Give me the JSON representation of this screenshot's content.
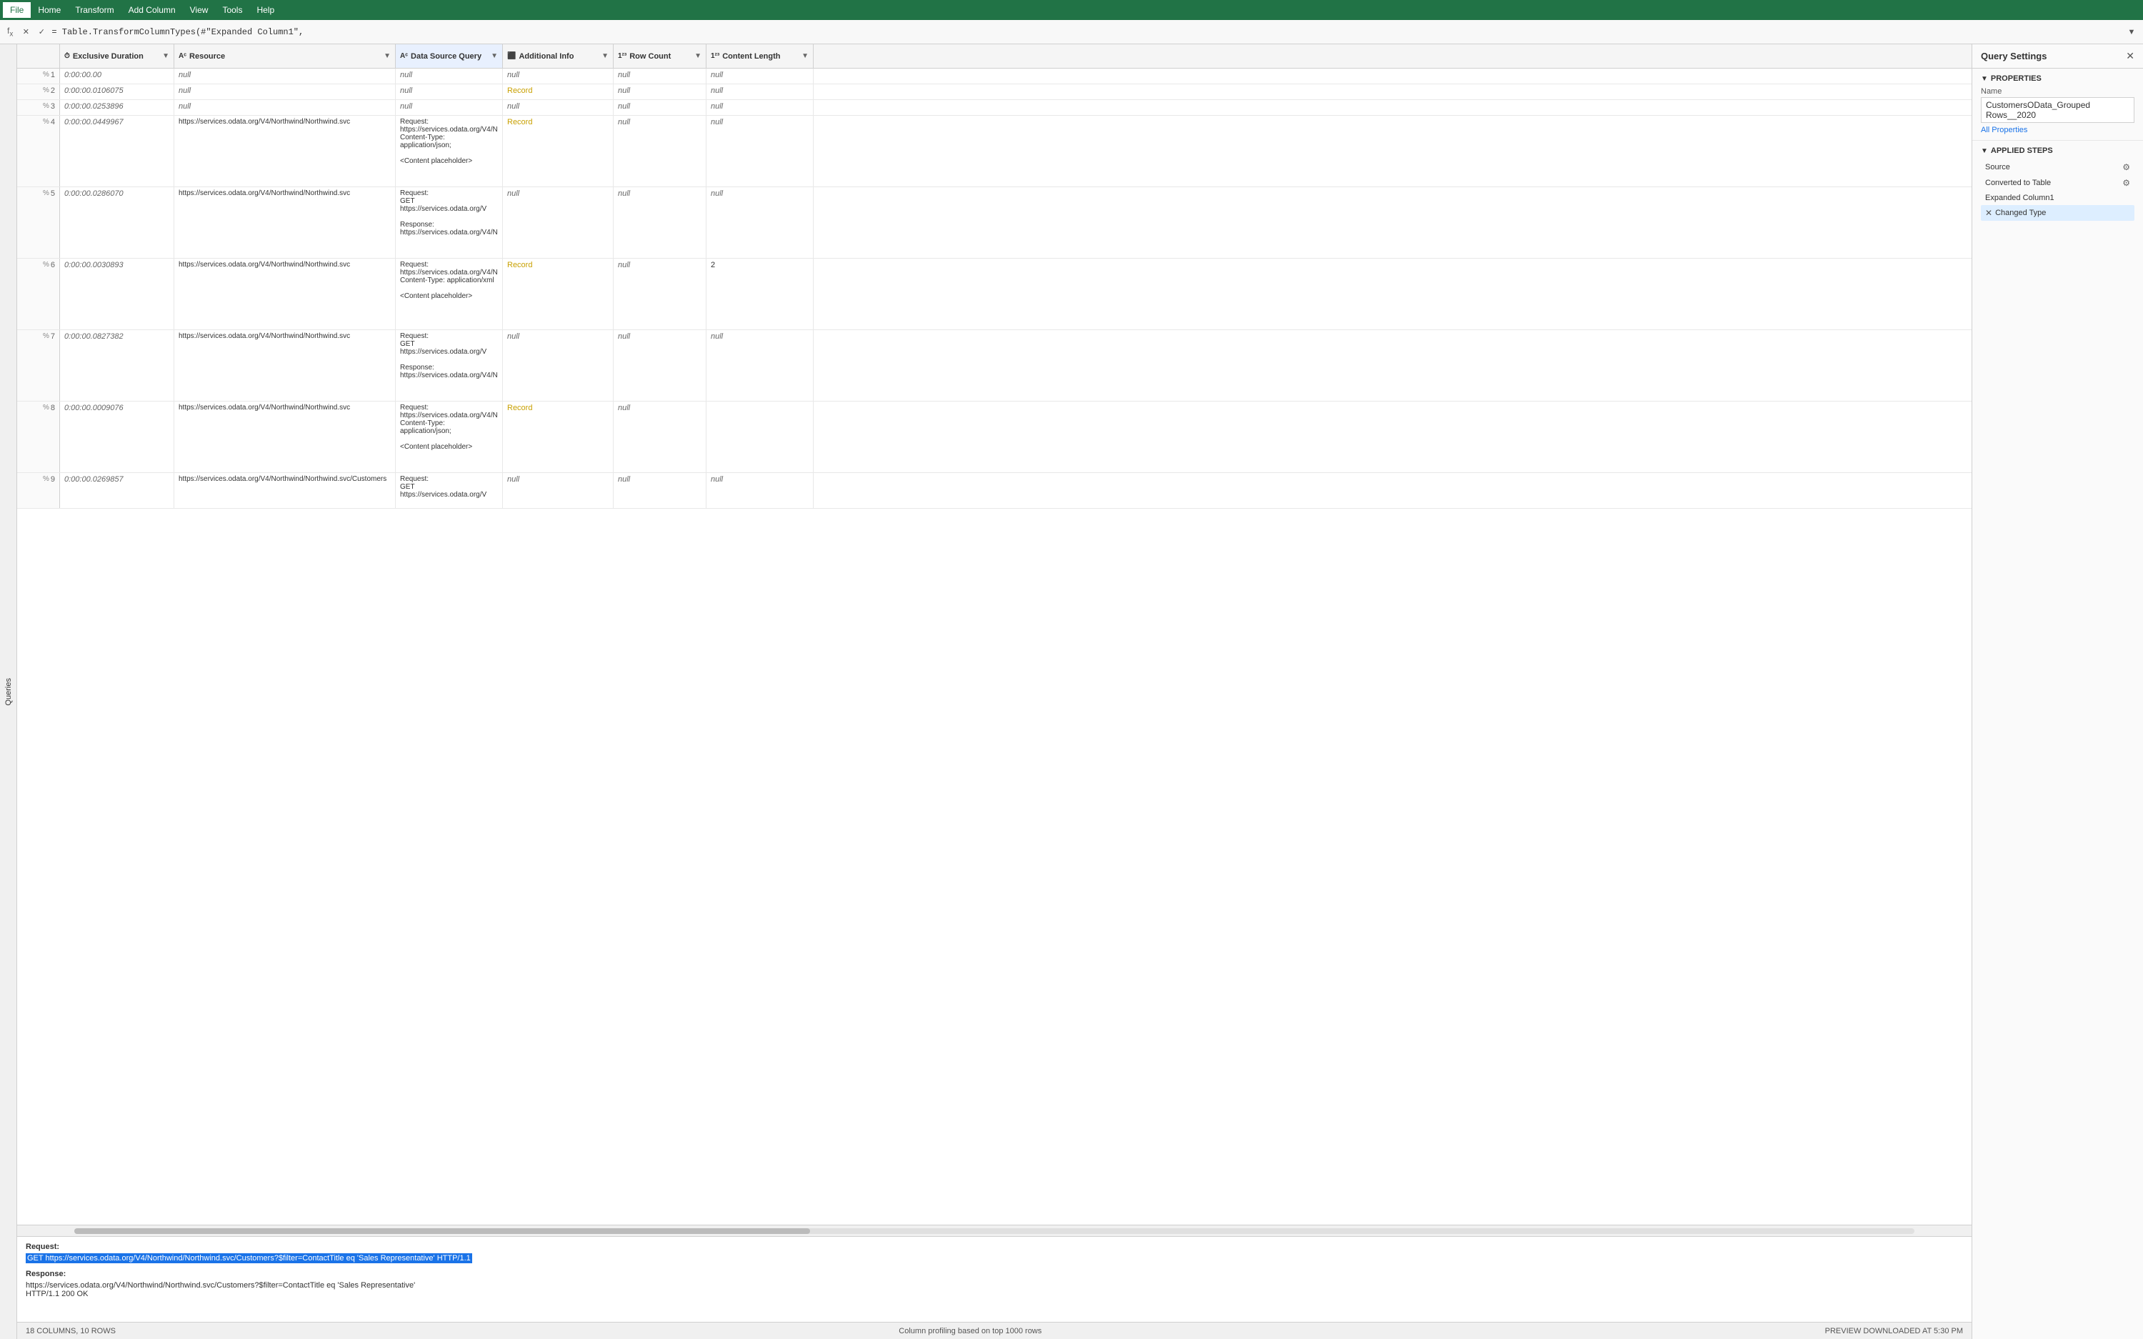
{
  "menu": {
    "file_label": "File",
    "home_label": "Home",
    "transform_label": "Transform",
    "add_column_label": "Add Column",
    "view_label": "View",
    "tools_label": "Tools",
    "help_label": "Help"
  },
  "formula_bar": {
    "formula_text": "= Table.TransformColumnTypes(#\"Expanded Column1\","
  },
  "columns": [
    {
      "id": "exclusive_duration",
      "label": "Exclusive Duration",
      "icon": "⏱"
    },
    {
      "id": "resource",
      "label": "Resource",
      "icon": "Aᵃ"
    },
    {
      "id": "data_source_query",
      "label": "Data Source Query",
      "icon": "Aᵃ"
    },
    {
      "id": "additional_info",
      "label": "Additional Info",
      "icon": "⬛"
    },
    {
      "id": "row_count",
      "label": "Row Count",
      "icon": "1²³"
    },
    {
      "id": "content_length",
      "label": "Content Length",
      "icon": "1²³"
    }
  ],
  "rows": [
    {
      "num": "1",
      "exclusive_duration": "0:00:00.00",
      "resource": "null",
      "data_source_query": "null",
      "additional_info": "null",
      "row_count": "null",
      "content_length": "null"
    },
    {
      "num": "2",
      "exclusive_duration": "0:00:00.0106075",
      "resource": "null",
      "data_source_query": "null",
      "additional_info": "Record",
      "additional_info_link": true,
      "row_count": "null",
      "content_length": "null"
    },
    {
      "num": "3",
      "exclusive_duration": "0:00:00.0253896",
      "resource": "null",
      "data_source_query": "null",
      "additional_info": "null",
      "row_count": "null",
      "content_length": "null"
    },
    {
      "num": "4",
      "exclusive_duration": "0:00:00.0449967",
      "resource": "https://services.odata.org/V4/Northwind/Northwind.svc",
      "data_source_query": "Request:\nhttps://services.odata.org/V4/N\nContent-Type: application/json;\n\n<Content placeholder>",
      "additional_info": "Record",
      "additional_info_link": true,
      "row_count": "null",
      "content_length": "null"
    },
    {
      "num": "5",
      "exclusive_duration": "0:00:00.0286070",
      "resource": "https://services.odata.org/V4/Northwind/Northwind.svc",
      "data_source_query": "Request:\nGET https://services.odata.org/V\n\nResponse:\nhttps://services.odata.org/V4/N",
      "additional_info": "null",
      "row_count": "null",
      "content_length": "null"
    },
    {
      "num": "6",
      "exclusive_duration": "0:00:00.0030893",
      "resource": "https://services.odata.org/V4/Northwind/Northwind.svc",
      "data_source_query": "Request:\nhttps://services.odata.org/V4/N\nContent-Type: application/xml\n\n<Content placeholder>",
      "additional_info": "Record",
      "additional_info_link": true,
      "row_count": "null",
      "content_length": "2"
    },
    {
      "num": "7",
      "exclusive_duration": "0:00:00.0827382",
      "resource": "https://services.odata.org/V4/Northwind/Northwind.svc",
      "data_source_query": "Request:\nGET https://services.odata.org/V\n\nResponse:\nhttps://services.odata.org/V4/N",
      "additional_info": "null",
      "row_count": "null",
      "content_length": "null"
    },
    {
      "num": "8",
      "exclusive_duration": "0:00:00.0009076",
      "resource": "https://services.odata.org/V4/Northwind/Northwind.svc",
      "data_source_query": "Request:\nhttps://services.odata.org/V4/N\nContent-Type: application/json;\n\n<Content placeholder>",
      "additional_info": "Record",
      "additional_info_link": true,
      "row_count": "null",
      "content_length": ""
    },
    {
      "num": "9",
      "exclusive_duration": "0:00:00.0269857",
      "resource": "https://services.odata.org/V4/Northwind/Northwind.svc/Customers",
      "data_source_query": "Request:\nGET https://services.odata.org/V",
      "additional_info": "null",
      "row_count": "null",
      "content_length": "null"
    }
  ],
  "preview": {
    "request_label": "Request:",
    "request_url": "GET https://services.odata.org/V4/Northwind/Northwind.svc/Customers?$filter=ContactTitle eq 'Sales Representative' HTTP/1.1",
    "response_label": "Response:",
    "response_url": "https://services.odata.org/V4/Northwind/Northwind.svc/Customers?$filter=ContactTitle eq 'Sales Representative'",
    "response_status": "HTTP/1.1 200 OK"
  },
  "status_bar": {
    "columns_info": "18 COLUMNS, 10 ROWS",
    "profile_info": "Column profiling based on top 1000 rows",
    "preview_info": "PREVIEW DOWNLOADED AT 5:30 PM"
  },
  "query_settings": {
    "panel_title": "Query Settings",
    "properties_section": "PROPERTIES",
    "name_label": "Name",
    "name_value": "CustomersOData_Grouped Rows__2020",
    "all_properties_link": "All Properties",
    "applied_steps_section": "APPLIED STEPS",
    "steps": [
      {
        "name": "Source",
        "has_gear": true,
        "is_active": false
      },
      {
        "name": "Converted to Table",
        "has_gear": true,
        "is_active": false
      },
      {
        "name": "Expanded Column1",
        "has_gear": false,
        "is_active": false
      },
      {
        "name": "Changed Type",
        "has_gear": false,
        "is_active": true,
        "has_x": true
      }
    ]
  }
}
